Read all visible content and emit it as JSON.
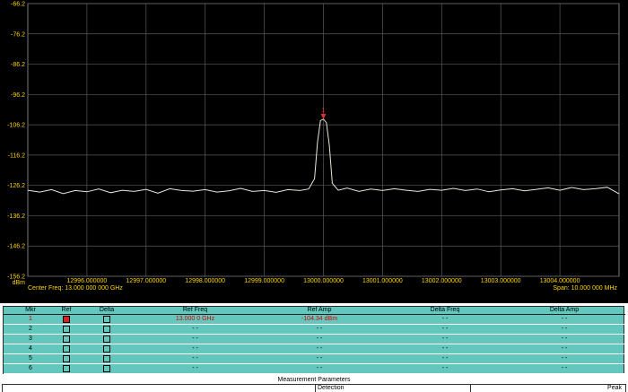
{
  "chart_data": {
    "type": "line",
    "y_tick_labels": [
      "-66.2",
      "-76.2",
      "-86.2",
      "-96.2",
      "-106.2",
      "-116.2",
      "-126.2",
      "-136.2",
      "-146.2",
      "-156.2"
    ],
    "y_unit": "dBm",
    "ylim": [
      -156.2,
      -66.2
    ],
    "x_tick_labels": [
      "12996.000000",
      "12997.000000",
      "12998.000000",
      "12999.000000",
      "13000.000000",
      "13001.000000",
      "13002.000000",
      "13003.000000",
      "13004.000000"
    ],
    "xlim": [
      12995.0,
      13005.0
    ],
    "grid": true,
    "series": [
      {
        "color": "#e8e8d8",
        "x": [
          12995.0,
          12995.2,
          12995.4,
          12995.6,
          12995.8,
          12996.0,
          12996.2,
          12996.4,
          12996.6,
          12996.8,
          12997.0,
          12997.2,
          12997.4,
          12997.6,
          12997.8,
          12998.0,
          12998.2,
          12998.4,
          12998.6,
          12998.8,
          12999.0,
          12999.2,
          12999.4,
          12999.6,
          12999.75,
          12999.85,
          12999.9,
          12999.95,
          13000.0,
          13000.05,
          13000.1,
          13000.15,
          13000.25,
          13000.4,
          13000.6,
          13000.8,
          13001.0,
          13001.2,
          13001.4,
          13001.6,
          13001.8,
          13002.0,
          13002.2,
          13002.4,
          13002.6,
          13002.8,
          13003.0,
          13003.2,
          13003.4,
          13003.6,
          13003.8,
          13004.0,
          13004.2,
          13004.4,
          13004.6,
          13004.8,
          13005.0
        ],
        "y": [
          -127.8,
          -128.4,
          -127.6,
          -128.9,
          -127.9,
          -128.3,
          -127.4,
          -128.6,
          -127.8,
          -128.2,
          -127.5,
          -128.8,
          -127.3,
          -127.9,
          -128.1,
          -127.6,
          -128.4,
          -128.0,
          -127.2,
          -128.2,
          -127.9,
          -128.5,
          -127.6,
          -127.9,
          -127.4,
          -124.0,
          -112.0,
          -104.8,
          -104.3,
          -105.5,
          -113.0,
          -125.5,
          -127.8,
          -127.1,
          -128.2,
          -127.4,
          -127.9,
          -127.3,
          -127.8,
          -128.2,
          -127.5,
          -127.8,
          -127.2,
          -127.9,
          -127.4,
          -128.3,
          -127.7,
          -127.3,
          -128.0,
          -127.5,
          -127.0,
          -127.8,
          -126.9,
          -127.6,
          -127.3,
          -126.8,
          -129.0
        ]
      }
    ],
    "marker": {
      "label": "1",
      "x": 13000.0,
      "y": -104.34,
      "color": "#e03030"
    }
  },
  "captions": {
    "center_freq": "Center Freq: 13.000 000 000 GHz",
    "span": "Span: 10.000 000 MHz"
  },
  "marker_table": {
    "headers": [
      "Mkr",
      "Ref",
      "Delta",
      "Ref Freq",
      "Ref Amp",
      "Delta Freq",
      "Delta Amp"
    ],
    "rows": [
      {
        "mkr": "1",
        "ref_checked": true,
        "delta_checked": false,
        "ref_freq": "13.000 0 GHz",
        "ref_amp": "-104.34 dBm",
        "delta_freq": "- -",
        "delta_amp": "- -"
      },
      {
        "mkr": "2",
        "ref_checked": false,
        "delta_checked": false,
        "ref_freq": "- -",
        "ref_amp": "- -",
        "delta_freq": "- -",
        "delta_amp": "- -"
      },
      {
        "mkr": "3",
        "ref_checked": false,
        "delta_checked": false,
        "ref_freq": "- -",
        "ref_amp": "- -",
        "delta_freq": "- -",
        "delta_amp": "- -"
      },
      {
        "mkr": "4",
        "ref_checked": false,
        "delta_checked": false,
        "ref_freq": "- -",
        "ref_amp": "- -",
        "delta_freq": "- -",
        "delta_amp": "- -"
      },
      {
        "mkr": "5",
        "ref_checked": false,
        "delta_checked": false,
        "ref_freq": "- -",
        "ref_amp": "- -",
        "delta_freq": "- -",
        "delta_amp": "- -"
      },
      {
        "mkr": "6",
        "ref_checked": false,
        "delta_checked": false,
        "ref_freq": "- -",
        "ref_amp": "- -",
        "delta_freq": "- -",
        "delta_amp": "- -"
      }
    ]
  },
  "measurement": {
    "title": "Measurement Parameters",
    "detection_label": "Detection",
    "peak_label": "Peak"
  }
}
